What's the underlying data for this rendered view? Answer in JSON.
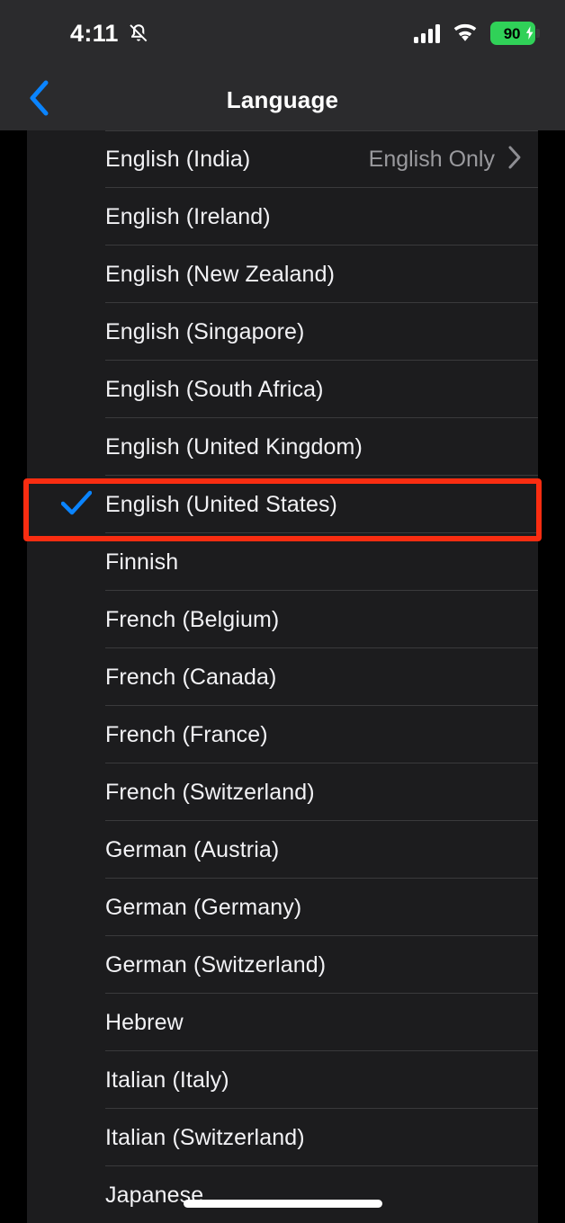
{
  "status_bar": {
    "time": "4:11",
    "silent_icon": "bell-slash-icon",
    "cellular_icon": "cellular-signal-icon",
    "wifi_icon": "wifi-icon",
    "battery_level": "90",
    "battery_charging_icon": "lightning-bolt-icon",
    "battery_color": "#30d158"
  },
  "header": {
    "back_icon": "chevron-left-icon",
    "back_accent_color": "#0a84ff",
    "title": "Language"
  },
  "annotation": {
    "color": "#f92d11",
    "target_row_label": "English (United States)"
  },
  "list": {
    "checkmark_icon": "checkmark-icon",
    "checkmark_color": "#0a84ff",
    "chevron_icon": "chevron-right-icon",
    "rows": [
      {
        "label": "English (India)",
        "value": "English Only",
        "checked": false,
        "has_chevron": true
      },
      {
        "label": "English (Ireland)",
        "value": "",
        "checked": false,
        "has_chevron": false
      },
      {
        "label": "English (New Zealand)",
        "value": "",
        "checked": false,
        "has_chevron": false
      },
      {
        "label": "English (Singapore)",
        "value": "",
        "checked": false,
        "has_chevron": false
      },
      {
        "label": "English (South Africa)",
        "value": "",
        "checked": false,
        "has_chevron": false
      },
      {
        "label": "English (United Kingdom)",
        "value": "",
        "checked": false,
        "has_chevron": false
      },
      {
        "label": "English (United States)",
        "value": "",
        "checked": true,
        "has_chevron": false
      },
      {
        "label": "Finnish",
        "value": "",
        "checked": false,
        "has_chevron": false
      },
      {
        "label": "French (Belgium)",
        "value": "",
        "checked": false,
        "has_chevron": false
      },
      {
        "label": "French (Canada)",
        "value": "",
        "checked": false,
        "has_chevron": false
      },
      {
        "label": "French (France)",
        "value": "",
        "checked": false,
        "has_chevron": false
      },
      {
        "label": "French (Switzerland)",
        "value": "",
        "checked": false,
        "has_chevron": false
      },
      {
        "label": "German (Austria)",
        "value": "",
        "checked": false,
        "has_chevron": false
      },
      {
        "label": "German (Germany)",
        "value": "",
        "checked": false,
        "has_chevron": false
      },
      {
        "label": "German (Switzerland)",
        "value": "",
        "checked": false,
        "has_chevron": false
      },
      {
        "label": "Hebrew",
        "value": "",
        "checked": false,
        "has_chevron": false
      },
      {
        "label": "Italian (Italy)",
        "value": "",
        "checked": false,
        "has_chevron": false
      },
      {
        "label": "Italian (Switzerland)",
        "value": "",
        "checked": false,
        "has_chevron": false
      },
      {
        "label": "Japanese",
        "value": "",
        "checked": false,
        "has_chevron": false
      }
    ]
  },
  "home_indicator": {
    "name": "home-indicator-bar"
  }
}
